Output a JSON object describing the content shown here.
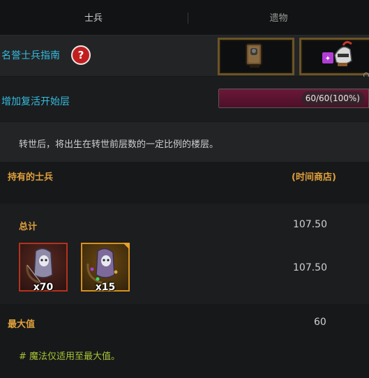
{
  "tabs": [
    {
      "label": "士兵"
    },
    {
      "label": "遗物"
    }
  ],
  "guide": {
    "label": "名誉士兵指南",
    "help_glyph": "?",
    "slot_icons": [
      "book-icon",
      "soldier-helmet-icon"
    ]
  },
  "revive": {
    "label": "增加复活开始层",
    "progress_text": "60/60(100%)",
    "progress": 1.0
  },
  "note": "转世后，将出生在转世前层数的一定比例的楼层。",
  "owned": {
    "label": "持有的士兵",
    "shop_label": "(时间商店)"
  },
  "total": {
    "label": "总计",
    "value": "107.50",
    "units_value": "107.50"
  },
  "units": [
    {
      "count": "x70",
      "frame_color": "#b6321c",
      "icon": "ghost-archer-icon"
    },
    {
      "count": "x15",
      "frame_color": "#d8921e",
      "icon": "ghost-archer-icon"
    }
  ],
  "max": {
    "label": "最大值",
    "value": "60"
  },
  "magic_note": "# 魔法仅适用至最大值。",
  "colors": {
    "accent_blue": "#33bde0",
    "accent_gold": "#e0a13b",
    "note_green": "#a7c535",
    "progress": "#6b1838"
  }
}
